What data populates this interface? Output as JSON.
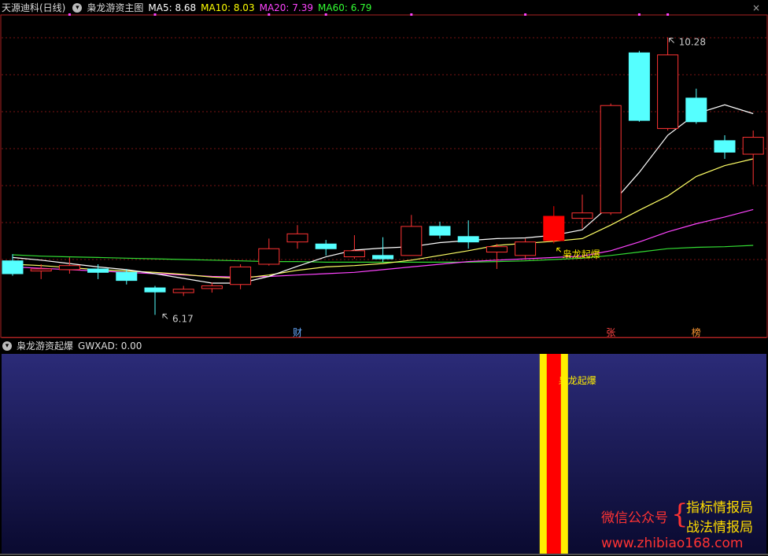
{
  "header": {
    "stock_name": "天源迪科(日线)",
    "indicator_name": "枭龙游资主图",
    "ma": [
      {
        "label": "MA5: 8.68",
        "color": "#ffffff"
      },
      {
        "label": "MA10: 8.03",
        "color": "#ffff00"
      },
      {
        "label": "MA20: 7.39",
        "color": "#ff44ff"
      },
      {
        "label": "MA60: 6.79",
        "color": "#33ff33"
      }
    ]
  },
  "chart_data": {
    "type": "candlestick",
    "price_range": [
      6.0,
      10.6
    ],
    "candles": [
      {
        "o": 6.97,
        "c": 6.78,
        "h": 7.07,
        "l": 6.75
      },
      {
        "o": 6.82,
        "c": 6.85,
        "h": 6.92,
        "l": 6.7
      },
      {
        "o": 6.84,
        "c": 6.9,
        "h": 7.02,
        "l": 6.78
      },
      {
        "o": 6.85,
        "c": 6.8,
        "h": 6.92,
        "l": 6.7
      },
      {
        "o": 6.8,
        "c": 6.68,
        "h": 6.85,
        "l": 6.62
      },
      {
        "o": 6.57,
        "c": 6.51,
        "h": 6.6,
        "l": 6.17
      },
      {
        "o": 6.5,
        "c": 6.55,
        "h": 6.6,
        "l": 6.45
      },
      {
        "o": 6.56,
        "c": 6.6,
        "h": 6.65,
        "l": 6.5
      },
      {
        "o": 6.62,
        "c": 6.88,
        "h": 6.92,
        "l": 6.55
      },
      {
        "o": 6.92,
        "c": 7.15,
        "h": 7.3,
        "l": 6.9
      },
      {
        "o": 7.25,
        "c": 7.37,
        "h": 7.5,
        "l": 7.15
      },
      {
        "o": 7.22,
        "c": 7.15,
        "h": 7.28,
        "l": 7.05
      },
      {
        "o": 7.03,
        "c": 7.12,
        "h": 7.35,
        "l": 7.0
      },
      {
        "o": 7.05,
        "c": 7.0,
        "h": 7.32,
        "l": 6.95
      },
      {
        "o": 7.05,
        "c": 7.48,
        "h": 7.65,
        "l": 7.05
      },
      {
        "o": 7.48,
        "c": 7.35,
        "h": 7.55,
        "l": 7.3
      },
      {
        "o": 7.33,
        "c": 7.25,
        "h": 7.57,
        "l": 7.15
      },
      {
        "o": 7.1,
        "c": 7.18,
        "h": 7.22,
        "l": 6.85
      },
      {
        "o": 7.05,
        "c": 7.25,
        "h": 7.3,
        "l": 7.0
      },
      {
        "o": 7.27,
        "c": 7.63,
        "h": 7.78,
        "l": 7.23
      },
      {
        "o": 7.6,
        "c": 7.68,
        "h": 7.95,
        "l": 7.45
      },
      {
        "o": 7.68,
        "c": 9.27,
        "h": 9.3,
        "l": 7.65
      },
      {
        "o": 10.05,
        "c": 9.05,
        "h": 10.08,
        "l": 9.03
      },
      {
        "o": 8.93,
        "c": 10.02,
        "h": 10.28,
        "l": 8.9
      },
      {
        "o": 9.38,
        "c": 9.03,
        "h": 9.52,
        "l": 9.0
      },
      {
        "o": 8.75,
        "c": 8.58,
        "h": 8.83,
        "l": 8.48
      },
      {
        "o": 8.55,
        "c": 8.8,
        "h": 8.9,
        "l": 8.1
      }
    ],
    "candle_styles": {
      "up": "#ff3333",
      "down": "#55ffff",
      "limit_up": "#ff0000"
    },
    "limit_up_index": 19,
    "ma5": [
      7.02,
      6.98,
      6.93,
      6.88,
      6.84,
      6.78,
      6.71,
      6.64,
      6.64,
      6.74,
      6.89,
      7.03,
      7.13,
      7.16,
      7.18,
      7.24,
      7.27,
      7.3,
      7.31,
      7.35,
      7.43,
      7.8,
      8.28,
      8.83,
      9.15,
      9.28,
      9.15
    ],
    "ma10": [
      6.92,
      6.9,
      6.87,
      6.84,
      6.82,
      6.8,
      6.77,
      6.73,
      6.71,
      6.76,
      6.83,
      6.88,
      6.9,
      6.93,
      6.98,
      7.05,
      7.12,
      7.2,
      7.23,
      7.26,
      7.3,
      7.5,
      7.72,
      7.93,
      8.22,
      8.38,
      8.48
    ],
    "ma20": [
      6.88,
      6.86,
      6.84,
      6.82,
      6.8,
      6.78,
      6.76,
      6.74,
      6.73,
      6.74,
      6.76,
      6.78,
      6.8,
      6.84,
      6.88,
      6.92,
      6.96,
      6.98,
      7.0,
      7.02,
      7.04,
      7.12,
      7.25,
      7.4,
      7.52,
      7.62,
      7.73
    ],
    "ma60": [
      7.06,
      7.04,
      7.03,
      7.02,
      7.01,
      7.0,
      6.99,
      6.98,
      6.97,
      6.96,
      6.96,
      6.95,
      6.95,
      6.95,
      6.95,
      6.95,
      6.95,
      6.96,
      6.97,
      6.99,
      7.01,
      7.05,
      7.1,
      7.15,
      7.17,
      7.18,
      7.2
    ],
    "ma_colors": {
      "ma5": "#ffffff",
      "ma10": "#ffff66",
      "ma20": "#ff44ff",
      "ma60": "#33dd33"
    },
    "annotations": {
      "high": "10.28",
      "low": "6.17",
      "signal": "枭龙起爆"
    },
    "top_dots_candle_index": [
      2,
      5,
      9,
      11,
      14,
      18,
      22,
      23
    ],
    "event_markers": [
      {
        "index": 10,
        "text": "财",
        "color": "#66aaff"
      },
      {
        "index": 21,
        "text": "张",
        "color": "#ff4444"
      },
      {
        "index": 24,
        "text": "榜",
        "color": "#ff9933"
      }
    ],
    "grid": true
  },
  "subchart": {
    "title": "枭龙游资起爆",
    "label": "GWXAD: 0.00",
    "signal_text": "枭龙起爆",
    "signal_index": 19,
    "colors": {
      "outer": "#ffee00",
      "inner": "#ff0000"
    }
  },
  "watermark": {
    "wechat": "微信公众号",
    "brace": "{",
    "line1": "指标情报局",
    "line2": "战法情报局",
    "url": "www.zhibiao168.com",
    "color_red": "#ff3333",
    "color_yellow": "#ffdd00"
  },
  "close_icon": "×"
}
